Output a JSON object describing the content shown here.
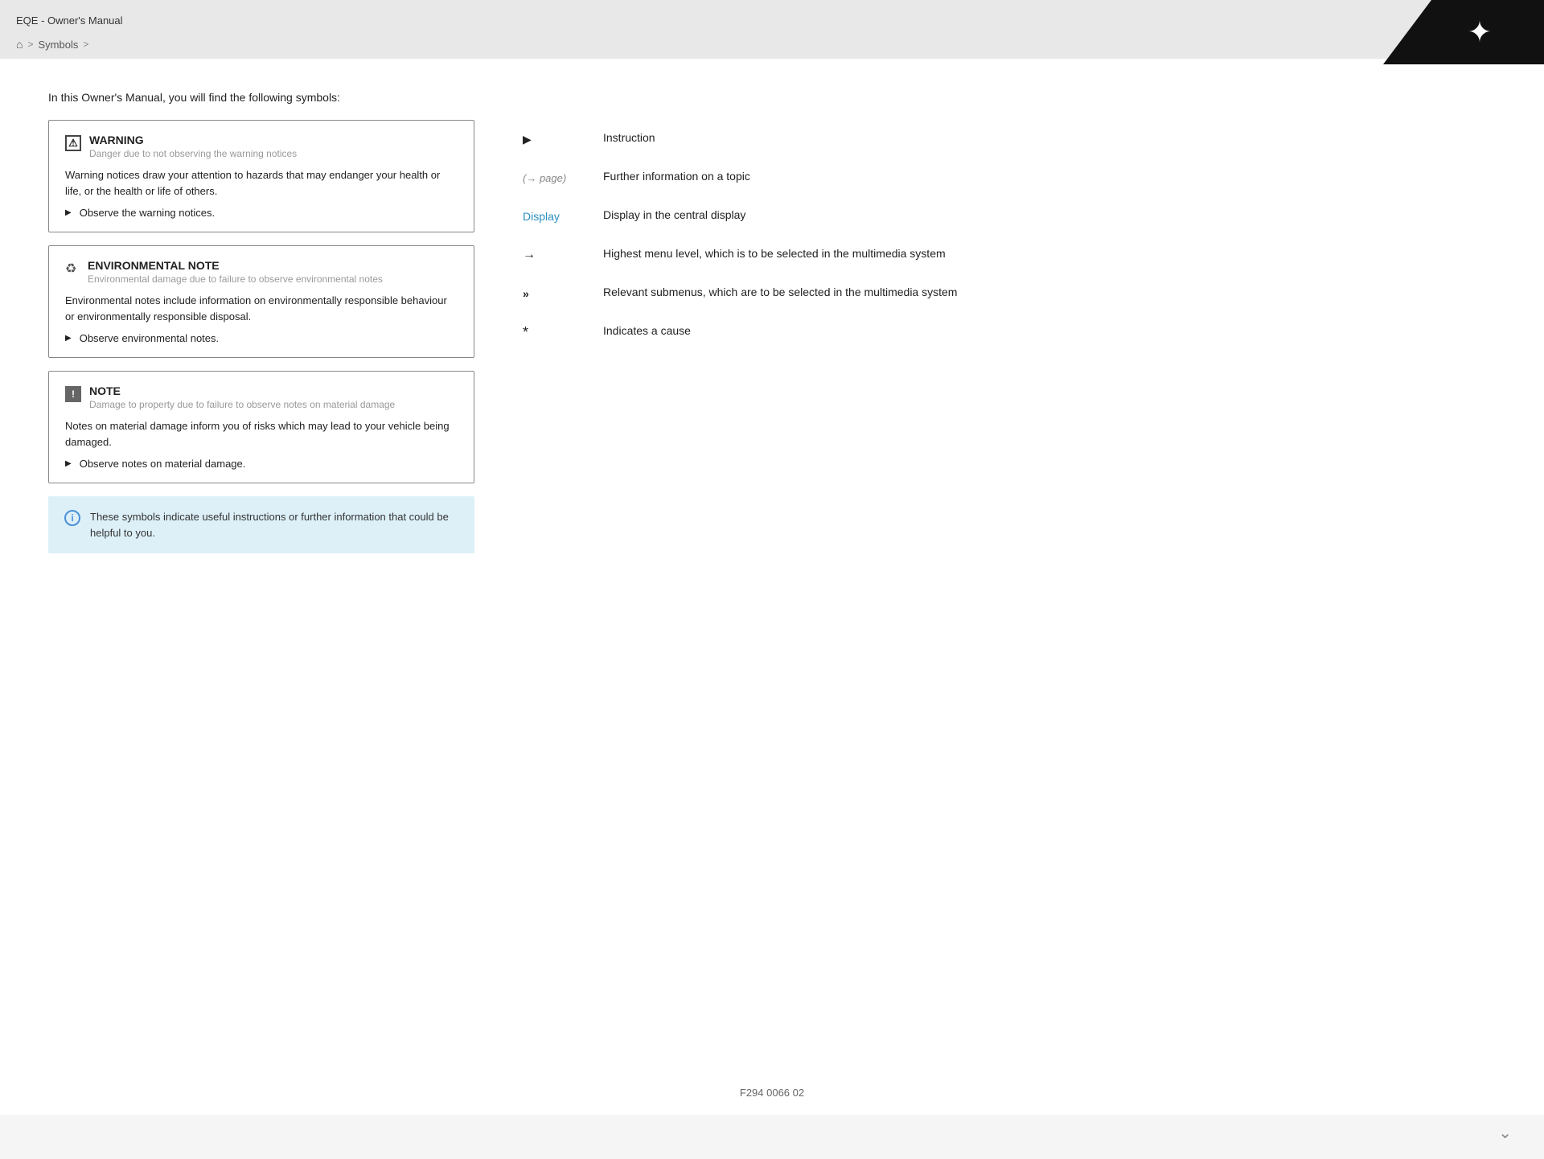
{
  "header": {
    "title": "EQE - Owner's Manual",
    "breadcrumb": {
      "home_label": "🏠",
      "sep1": ">",
      "item1": "Symbols",
      "sep2": ">"
    }
  },
  "main": {
    "intro": "In this Owner's Manual, you will find the following symbols:",
    "notices": [
      {
        "type": "warning",
        "title": "WARNING",
        "subtitle": "Danger due to not observing the warning notices",
        "body": "Warning notices draw your attention to hazards that may endanger your health or life, or the health or life of others.",
        "instruction": "Observe the warning notices."
      },
      {
        "type": "environmental",
        "title": "ENVIRONMENTAL NOTE",
        "subtitle": "Environmental damage due to failure to observe environmental notes",
        "body": "Environmental notes include information on environmentally responsible behaviour or environmentally responsible disposal.",
        "instruction": "Observe environmental notes."
      },
      {
        "type": "note",
        "title": "NOTE",
        "subtitle": "Damage to property due to failure to observe notes on material damage",
        "body": "Notes on material damage inform you of risks which may lead to your vehicle being damaged.",
        "instruction": "Observe notes on material damage."
      }
    ],
    "info_box": {
      "text": "These symbols indicate useful instructions or further information that could be helpful to you."
    },
    "symbols": [
      {
        "symbol": "▶",
        "description": "Instruction"
      },
      {
        "symbol": "(→ page)",
        "description": "Further information on a topic"
      },
      {
        "symbol": "Display",
        "description": "Display in the central display",
        "is_link": true
      },
      {
        "symbol": "→",
        "description": "Highest menu level, which is to be selected in the multimedia system",
        "is_nav": true
      },
      {
        "symbol": "»",
        "description": "Relevant submenus, which are to be selected in the multimedia system"
      },
      {
        "symbol": "*",
        "description": "Indicates a cause"
      }
    ]
  },
  "footer": {
    "code": "F294 0066 02"
  }
}
